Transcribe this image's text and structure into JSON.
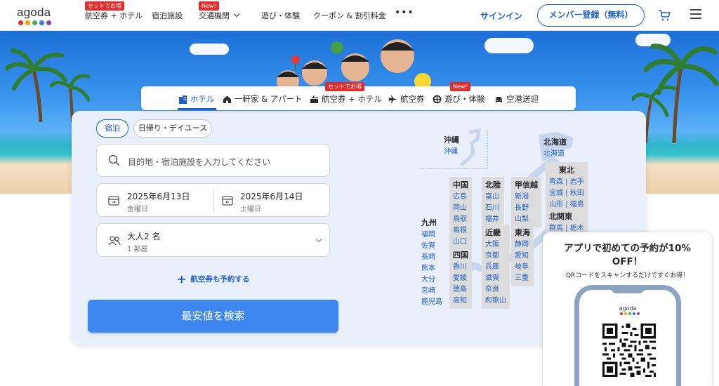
{
  "header": {
    "logo": "agoda",
    "logo_colors": [
      "#e12d2d",
      "#f4a200",
      "#4caf50",
      "#2b7de9",
      "#8e44ad",
      "#00a3e0"
    ],
    "nav": [
      {
        "label": "航空券 + ホテル",
        "badge": "セットでお得"
      },
      {
        "label": "宿泊施設"
      },
      {
        "label": "交通機関",
        "badge": "New!"
      },
      {
        "label": "遊び・体験"
      },
      {
        "label": "クーポン & 割引料金"
      }
    ],
    "more": "•••",
    "signin": "サインイン",
    "register": "メンバー登録（無料）"
  },
  "tabs": [
    {
      "label": "ホテル",
      "active": true,
      "icon": "hotel-icon"
    },
    {
      "label": "一軒家 & アパート",
      "icon": "house-icon"
    },
    {
      "label": "航空券 + ホテル",
      "badge": "セットでお得",
      "icon": "flight-hotel-icon"
    },
    {
      "label": "航空券",
      "icon": "plane-icon"
    },
    {
      "label": "遊び・体験",
      "badge": "New!",
      "icon": "activity-icon"
    },
    {
      "label": "空港送迎",
      "icon": "car-icon"
    }
  ],
  "search": {
    "mode_tabs": [
      "宿泊",
      "日帰り・デイユース"
    ],
    "destination_placeholder": "目的地・宿泊施設を入力してください",
    "checkin": {
      "date": "2025年6月13日",
      "weekday": "金曜日"
    },
    "checkout": {
      "date": "2025年6月14日",
      "weekday": "土曜日"
    },
    "guests": {
      "main": "大人2 名",
      "sub": "1 部屋"
    },
    "add_flight": "航空券も予約する",
    "submit": "最安値を検索"
  },
  "map": {
    "regions": [
      {
        "title": "沖縄",
        "items": [
          "沖縄"
        ]
      },
      {
        "title": "北海道",
        "items": [
          "北海道"
        ]
      },
      {
        "title": "東北",
        "items": [
          "青森 | 岩手",
          "宮城 | 秋田",
          "山形 | 福島"
        ]
      },
      {
        "title": "中国",
        "items": [
          "広島",
          "岡山",
          "鳥取",
          "島根",
          "山口"
        ]
      },
      {
        "title": "北陸",
        "items": [
          "富山",
          "石川",
          "福井"
        ]
      },
      {
        "title": "甲信越",
        "items": [
          "新潟",
          "長野",
          "山梨"
        ]
      },
      {
        "title": "北関東",
        "items": [
          "群馬 | 栃木"
        ]
      },
      {
        "title": "九州",
        "items": [
          "福岡",
          "佐賀",
          "長崎",
          "熊本",
          "大分",
          "宮崎",
          "鹿児島"
        ]
      },
      {
        "title": "近畿",
        "items": [
          "大阪",
          "京都",
          "兵庫",
          "滋賀",
          "奈良",
          "和歌山"
        ]
      },
      {
        "title": "東海",
        "items": [
          "静岡",
          "愛知",
          "岐阜",
          "三重"
        ]
      },
      {
        "title": "四国",
        "items": [
          "香川",
          "愛媛",
          "徳島",
          "高知"
        ]
      }
    ]
  },
  "promo": {
    "title_line1": "アプリで初めての予約が10%",
    "title_line2": "OFF！",
    "subtitle": "QRコードをスキャンするだけですぐお得！",
    "phone_logo": "agoda"
  }
}
